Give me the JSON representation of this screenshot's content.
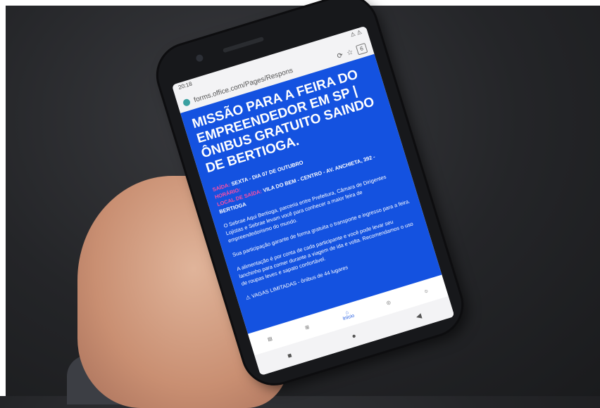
{
  "status": {
    "time": "20:18",
    "icons": "⚠ ⚠"
  },
  "browser": {
    "url": "forms.office.com/Pages/Respons",
    "tab_count": "6"
  },
  "form": {
    "title": "MISSÃO PARA A FEIRA DO EMPREENDEDOR EM SP | ÔNIBUS GRATUITO SAINDO DE BERTIOGA.",
    "saida_label": "SAÍDA:",
    "saida_value": "SEXTA - DIA 07 DE OUTUBRO",
    "horario_label": "HORÁRIO:",
    "horario_value": "",
    "local_label": "LOCAL DE SAÍDA:",
    "local_value": "VILA DO BEM - CENTRO - AV. ANCHIETA, 392 - BERTIOGA",
    "para1": "O Sebrae Aqui Bertioga, parceria entre Prefeitura, Câmara de Dirigentes Lojistas e Sebrae levam você para conhecer a maior feira de empreendedorismo do mundo.",
    "para2": "Sua participação garante de forma gratuita o transporte e ingresso para a feira.",
    "para3": "A alimentação é por conta de cada participante e você pode levar seu lanchinho para comer durante a viagem de ida e volta. Recomendamos o uso de roupas leves e sapato confortável.",
    "vagas": "⚠ VAGAS LIMITADAS - ônibus de 44 lugares"
  },
  "nav": {
    "home_label": "Início"
  }
}
